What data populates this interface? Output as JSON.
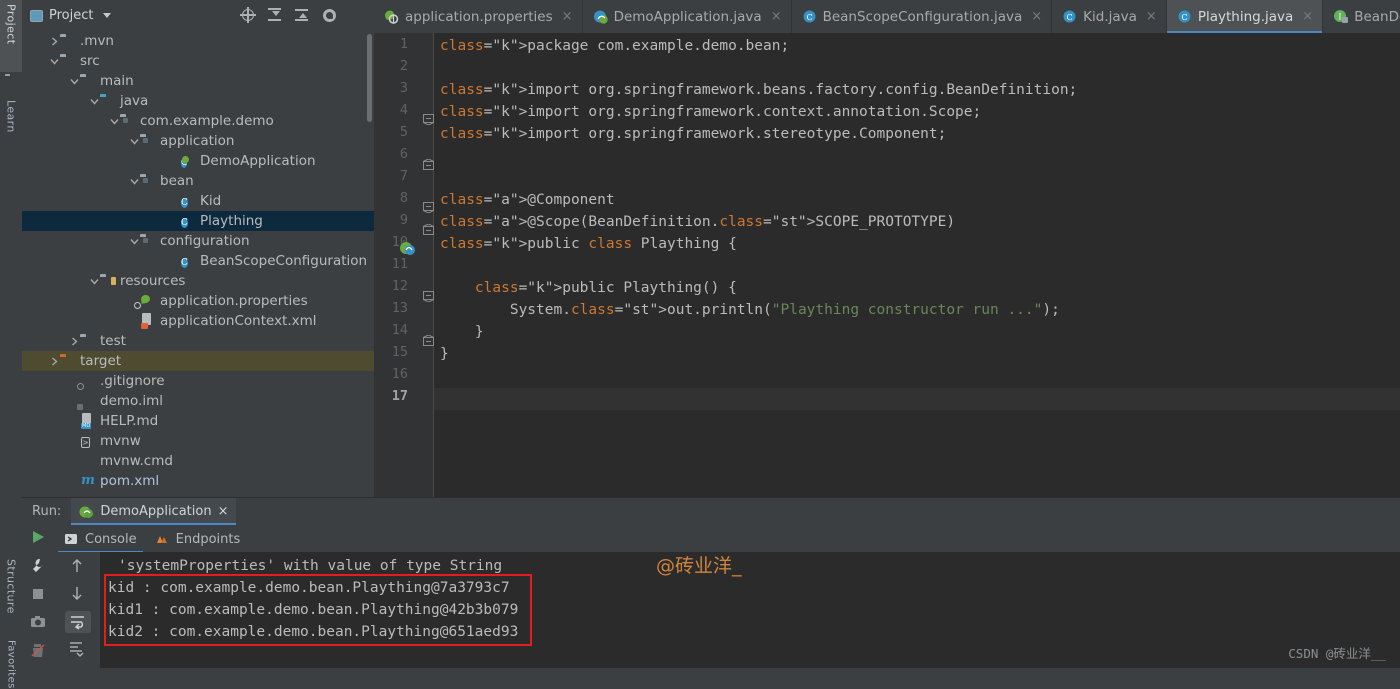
{
  "rail": {
    "tabs": [
      {
        "label": "Project",
        "icon": "folder-icon",
        "active": true
      },
      {
        "label": "Learn",
        "icon": "diamond-icon",
        "active": false
      },
      {
        "label": "Structure",
        "icon": "grid-icon",
        "active": false
      },
      {
        "label": "Favorites",
        "icon": "star-icon",
        "active": false
      }
    ]
  },
  "project_panel": {
    "title": "Project",
    "tools": [
      "locate-icon",
      "expand-all-icon",
      "collapse-all-icon",
      "gear-icon",
      "minimize-icon"
    ],
    "tree": [
      {
        "label": ".mvn",
        "indent": 1,
        "arrow": "right",
        "icon": "folder",
        "state": "normal"
      },
      {
        "label": "src",
        "indent": 1,
        "arrow": "down",
        "icon": "folder",
        "state": "normal"
      },
      {
        "label": "main",
        "indent": 2,
        "arrow": "down",
        "icon": "folder",
        "state": "normal"
      },
      {
        "label": "java",
        "indent": 3,
        "arrow": "down",
        "icon": "folder-blue",
        "state": "normal"
      },
      {
        "label": "com.example.demo",
        "indent": 4,
        "arrow": "down",
        "icon": "package",
        "state": "normal"
      },
      {
        "label": "application",
        "indent": 5,
        "arrow": "down",
        "icon": "package",
        "state": "normal"
      },
      {
        "label": "DemoApplication",
        "indent": 7,
        "arrow": "none",
        "icon": "spring-class",
        "state": "normal"
      },
      {
        "label": "bean",
        "indent": 5,
        "arrow": "down",
        "icon": "package",
        "state": "normal"
      },
      {
        "label": "Kid",
        "indent": 7,
        "arrow": "none",
        "icon": "class",
        "state": "normal"
      },
      {
        "label": "Plaything",
        "indent": 7,
        "arrow": "none",
        "icon": "class",
        "state": "selected"
      },
      {
        "label": "configuration",
        "indent": 5,
        "arrow": "down",
        "icon": "package",
        "state": "normal"
      },
      {
        "label": "BeanScopeConfiguration",
        "indent": 7,
        "arrow": "none",
        "icon": "class",
        "state": "normal"
      },
      {
        "label": "resources",
        "indent": 3,
        "arrow": "down",
        "icon": "resources",
        "state": "normal"
      },
      {
        "label": "application.properties",
        "indent": 5,
        "arrow": "none",
        "icon": "properties",
        "state": "normal"
      },
      {
        "label": "applicationContext.xml",
        "indent": 5,
        "arrow": "none",
        "icon": "xml",
        "state": "normal"
      },
      {
        "label": "test",
        "indent": 2,
        "arrow": "right",
        "icon": "folder",
        "state": "normal"
      },
      {
        "label": "target",
        "indent": 1,
        "arrow": "right",
        "icon": "folder-orange",
        "state": "target"
      },
      {
        "label": ".gitignore",
        "indent": 2,
        "arrow": "none",
        "icon": "git",
        "state": "normal"
      },
      {
        "label": "demo.iml",
        "indent": 2,
        "arrow": "none",
        "icon": "file",
        "state": "normal"
      },
      {
        "label": "HELP.md",
        "indent": 2,
        "arrow": "none",
        "icon": "md",
        "state": "normal"
      },
      {
        "label": "mvnw",
        "indent": 2,
        "arrow": "none",
        "icon": "shell",
        "state": "normal"
      },
      {
        "label": "mvnw.cmd",
        "indent": 2,
        "arrow": "none",
        "icon": "cmd",
        "state": "normal"
      },
      {
        "label": "pom.xml",
        "indent": 2,
        "arrow": "none",
        "icon": "maven",
        "state": "link"
      }
    ]
  },
  "editor_tabs": [
    {
      "label": "application.properties",
      "icon": "properties-icon",
      "active": false,
      "close": "×"
    },
    {
      "label": "DemoApplication.java",
      "icon": "spring-class-icon",
      "active": false,
      "close": "×"
    },
    {
      "label": "BeanScopeConfiguration.java",
      "icon": "class-icon",
      "active": false,
      "close": "×"
    },
    {
      "label": "Kid.java",
      "icon": "class-icon",
      "active": false,
      "close": "×"
    },
    {
      "label": "Plaything.java",
      "icon": "class-icon",
      "active": true,
      "close": "×"
    },
    {
      "label": "BeanDefinitionCustomizer.class",
      "icon": "interface-icon",
      "active": false,
      "close": "×"
    }
  ],
  "editor": {
    "line_numbers": [
      "1",
      "2",
      "3",
      "4",
      "5",
      "6",
      "7",
      "8",
      "9",
      "10",
      "11",
      "12",
      "13",
      "14",
      "15",
      "16",
      "17"
    ],
    "current_line": 17,
    "lines": [
      {
        "n": 1,
        "text": "package com.example.demo.bean;"
      },
      {
        "n": 2,
        "text": ""
      },
      {
        "n": 3,
        "text": "import org.springframework.beans.factory.config.BeanDefinition;"
      },
      {
        "n": 4,
        "text": "import org.springframework.context.annotation.Scope;"
      },
      {
        "n": 5,
        "text": "import org.springframework.stereotype.Component;"
      },
      {
        "n": 6,
        "text": ""
      },
      {
        "n": 7,
        "text": ""
      },
      {
        "n": 8,
        "text": "@Component"
      },
      {
        "n": 9,
        "text": "@Scope(BeanDefinition.SCOPE_PROTOTYPE)"
      },
      {
        "n": 10,
        "text": "public class Plaything {"
      },
      {
        "n": 11,
        "text": ""
      },
      {
        "n": 12,
        "text": "    public Plaything() {"
      },
      {
        "n": 13,
        "text": "        System.out.println(\"Plaything constructor run ...\");"
      },
      {
        "n": 14,
        "text": "    }"
      },
      {
        "n": 15,
        "text": "}"
      },
      {
        "n": 16,
        "text": ""
      },
      {
        "n": 17,
        "text": ""
      }
    ],
    "colors": {
      "background": "#2b2b2b",
      "gutter": "#313335",
      "keyword": "#cc7832",
      "string": "#6a8759",
      "annotation": "#bbb529",
      "static_field": "#9876aa",
      "identifier": "#a9b7c6"
    }
  },
  "run_panel": {
    "run_label": "Run:",
    "run_tab": "DemoApplication",
    "run_tab_close": "×",
    "sub_tabs": [
      {
        "label": "Console",
        "icon": "console-icon",
        "active": true
      },
      {
        "label": "Endpoints",
        "icon": "endpoints-icon",
        "active": false
      }
    ],
    "left_tools": [
      "run-icon",
      "wrench-icon",
      "stop-icon",
      "camera-icon",
      "rerun-icon"
    ],
    "console_tools": [
      "arrow-up-icon",
      "arrow-down-icon",
      "soft-wrap-icon",
      "scroll-to-end-icon"
    ],
    "console_lines": [
      "'systemProperties' with value of type String",
      "kid : com.example.demo.bean.Plaything@7a3793c7",
      "kid1 : com.example.demo.bean.Plaything@42b3b079",
      "kid2 : com.example.demo.bean.Plaything@651aed93"
    ],
    "highlight_color": "#e02020"
  },
  "watermarks": {
    "inline": "@砖业洋_",
    "corner": "CSDN @砖业洋__",
    "inline_color": "#d2843c"
  }
}
